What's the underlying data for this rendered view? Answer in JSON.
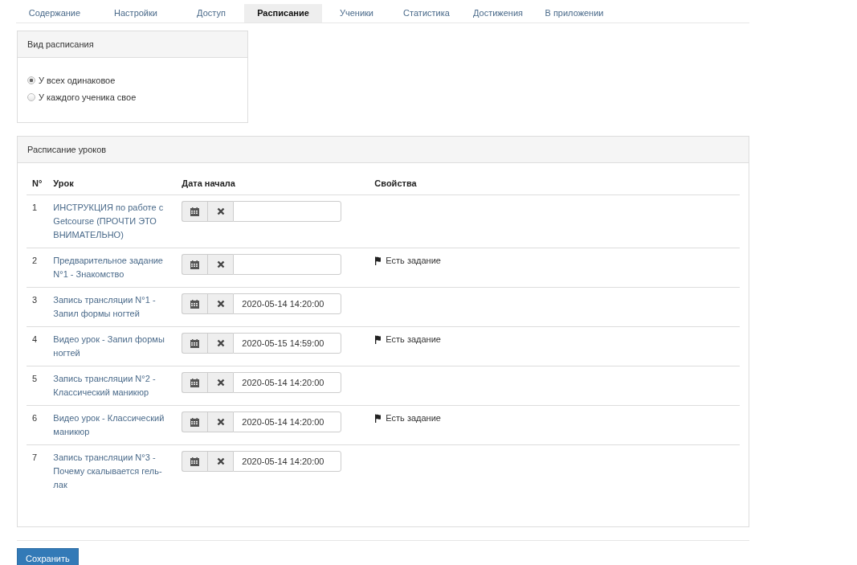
{
  "tabs": [
    {
      "label": "Содержание",
      "selected": false
    },
    {
      "label": "Настройки",
      "selected": false
    },
    {
      "label": "Доступ",
      "selected": false
    },
    {
      "label": "Расписание",
      "selected": true
    },
    {
      "label": "Ученики",
      "selected": false
    },
    {
      "label": "Статистика",
      "selected": false
    },
    {
      "label": "Достижения",
      "selected": false
    },
    {
      "label": "В приложении",
      "selected": false
    }
  ],
  "schedule_type": {
    "title": "Вид расписания",
    "options": [
      {
        "label": "У всех одинаковое",
        "selected": true
      },
      {
        "label": "У каждого ученика свое",
        "selected": false
      }
    ]
  },
  "lessons": {
    "title": "Расписание уроков",
    "columns": [
      "N°",
      "Урок",
      "Дата начала",
      "Свойства"
    ],
    "rows": [
      {
        "number": "1",
        "lesson": "ИНСТРУКЦИЯ по работе с Getcourse (ПРОЧТИ ЭТО ВНИМАТЕЛЬНО)"
      },
      {
        "number": "2",
        "lesson": "Предварительное задание N°1 - Знакомство",
        "property": "Есть задание"
      },
      {
        "number": "3",
        "lesson": "Запись трансляции N°1 - Запил формы ногтей",
        "date": "2020-05-14 14:20:00"
      },
      {
        "number": "4",
        "lesson": "Видео урок - Запил формы ногтей",
        "date": "2020-05-15 14:59:00",
        "property": "Есть задание"
      },
      {
        "number": "5",
        "lesson": "Запись трансляции N°2 - Классический маникюр",
        "date": "2020-05-14 14:20:00"
      },
      {
        "number": "6",
        "lesson": "Видео урок - Классический маникюр",
        "date": "2020-05-14 14:20:00",
        "property": "Есть задание"
      },
      {
        "number": "7",
        "lesson": "Запись трансляции N°3 - Почему скалывается гель-лак",
        "date": "2020-05-14 14:20:00"
      }
    ]
  },
  "save_button": "Сохранить"
}
